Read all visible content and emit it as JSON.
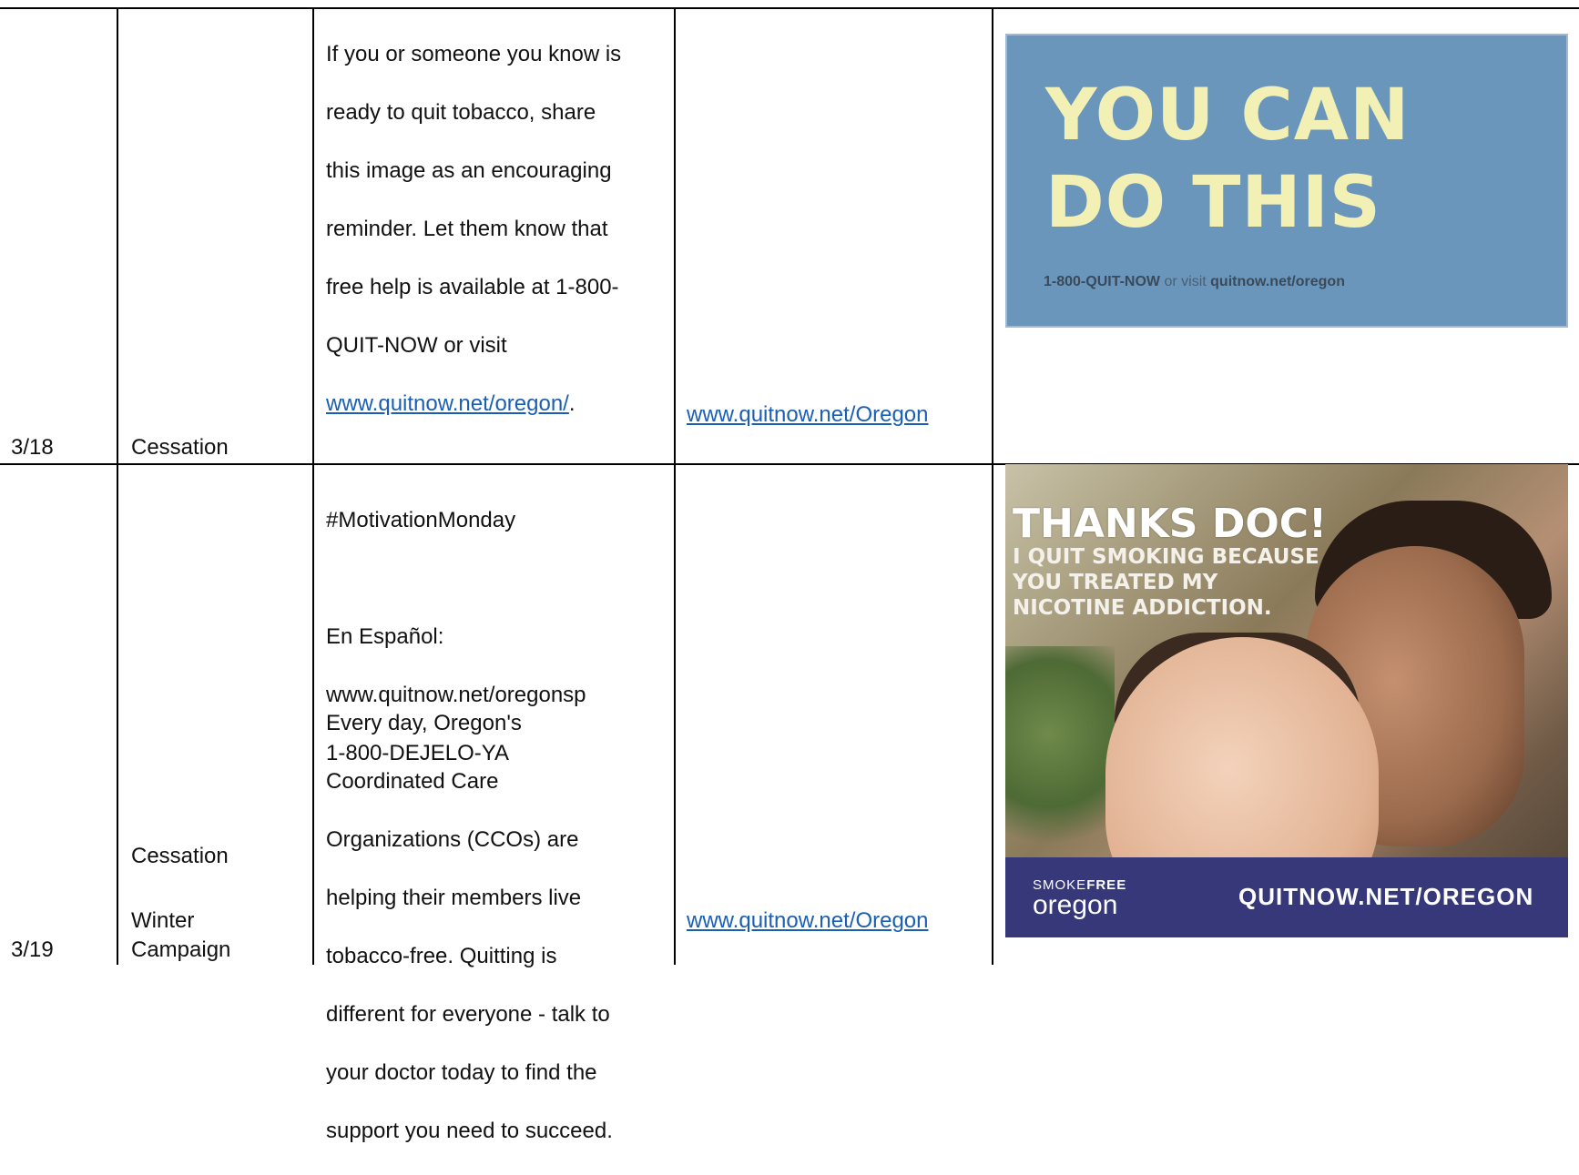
{
  "rows": [
    {
      "date": "3/18",
      "category_lines": [
        "Cessation"
      ],
      "message": {
        "lines": [
          "If you or someone you know is",
          "ready to quit tobacco, share",
          "this image as an encouraging",
          "reminder. Let them know that",
          "free help is available at 1-800-",
          "QUIT-NOW or visit"
        ],
        "link_text": "www.quitnow.net/oregon/",
        "link_suffix": ".",
        "hashtag": "#MotivationMonday",
        "spanish_label": "En Español:",
        "spanish_url": "www.quitnow.net/oregonsp",
        "spanish_phone": "1-800-DEJELO-YA"
      },
      "url": "www.quitnow.net/Oregon",
      "image": {
        "headline_line1": "YOU CAN",
        "headline_line2": "DO THIS",
        "phone": "1-800-QUIT-NOW",
        "connector": " or visit ",
        "site": "quitnow.net/oregon"
      }
    },
    {
      "date": "3/19",
      "category_lines": [
        "Cessation",
        "Winter",
        "Campaign"
      ],
      "message": {
        "lines": [
          "Every day, Oregon's",
          "Coordinated Care",
          "Organizations (CCOs) are",
          "helping their members live",
          "tobacco-free. Quitting is",
          "different for everyone - talk to",
          "your doctor today to find the",
          "support you need to succeed."
        ]
      },
      "url": "www.quitnow.net/Oregon",
      "image": {
        "headline": "THANKS DOC!",
        "subline": "I QUIT SMOKING BECAUSE\nYOU TREATED MY\nNICOTINE ADDICTION.",
        "brand_small_a": "SMOKE",
        "brand_small_b": "FREE",
        "brand_large": "oregon",
        "footer_url": "QUITNOW.NET/OREGON"
      }
    }
  ]
}
